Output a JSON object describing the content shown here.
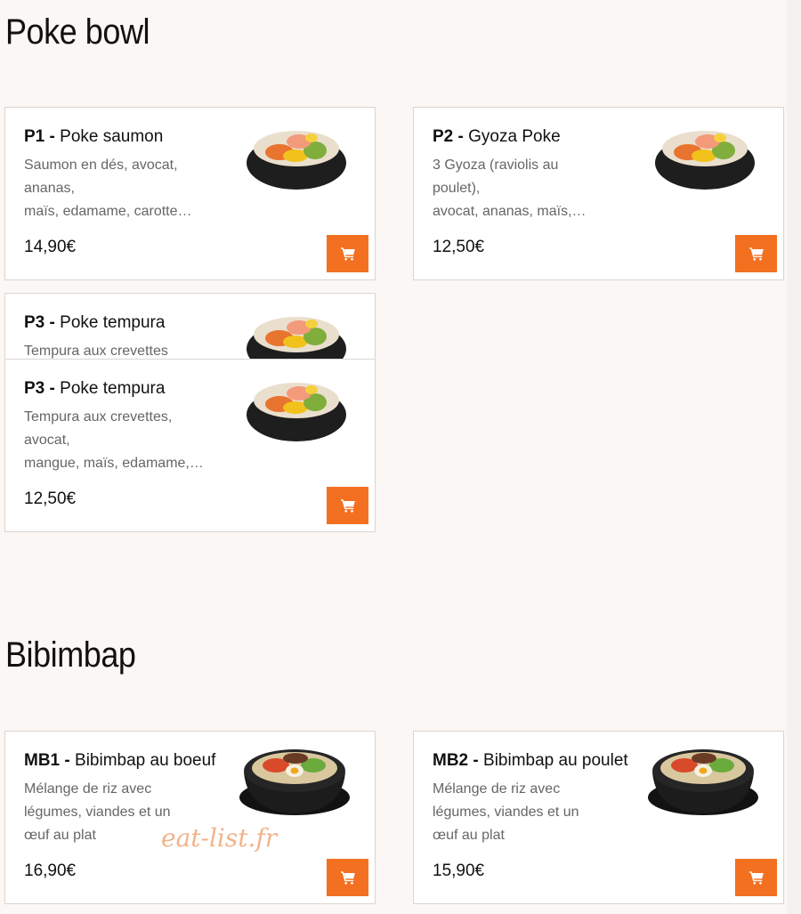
{
  "sections": [
    {
      "title": "Poke bowl",
      "items": [
        {
          "code": "P1 -",
          "name": "Poke saumon",
          "desc": [
            "Saumon en dés, avocat,",
            "ananas,",
            "maïs, edamame, carotte…"
          ],
          "price": "14,90€"
        },
        {
          "code": "P2 -",
          "name": "Gyoza Poke",
          "desc": [
            "3 Gyoza (raviolis au",
            "poulet),",
            "avocat, ananas, maïs,…"
          ],
          "price": "12,50€"
        },
        {
          "code": "P3 -",
          "name": "Poke tempura",
          "desc": [
            "Tempura aux crevettes"
          ]
        },
        {
          "code": "P3 -",
          "name": "Poke tempura",
          "desc": [
            "Tempura aux crevettes,",
            "avocat,",
            "mangue, maïs, edamame,…"
          ],
          "price": "12,50€"
        }
      ]
    },
    {
      "title": "Bibimbap",
      "items": [
        {
          "code": "MB1 -",
          "name": "Bibimbap au boeuf",
          "desc": [
            "Mélange de riz avec",
            "légumes, viandes et un",
            "œuf au plat"
          ],
          "price": "16,90€"
        },
        {
          "code": "MB2 -",
          "name": "Bibimbap au poulet",
          "desc": [
            "Mélange de riz avec",
            "légumes, viandes et un",
            "œuf au plat"
          ],
          "price": "15,90€"
        }
      ]
    }
  ],
  "watermark": "eat-list.fr",
  "icons": {
    "cart": "cart-icon",
    "poke": "poke-bowl-image",
    "bibimbap": "bibimbap-pot-image"
  },
  "colors": {
    "accent": "#f37021",
    "background": "#faf7f4",
    "card_border": "#d9d6d2",
    "desc_text": "#666666",
    "watermark": "#f1ab7e"
  }
}
